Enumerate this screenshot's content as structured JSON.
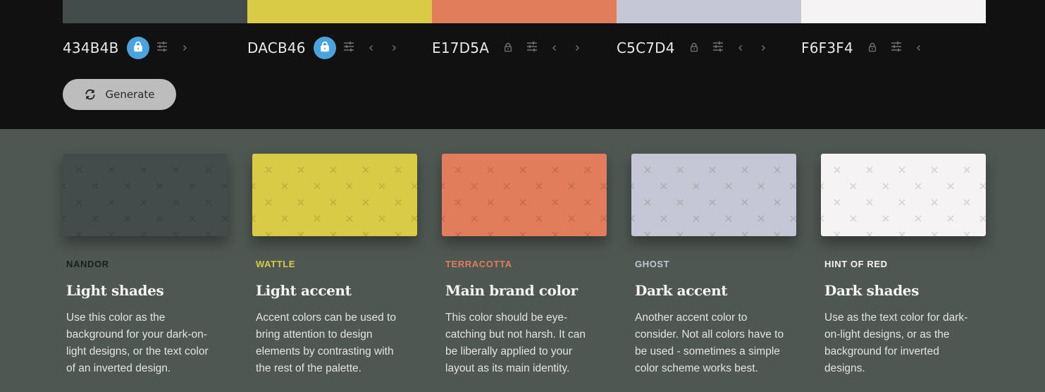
{
  "icons": {
    "lock": "lock-icon",
    "adjust": "sliders-icon",
    "prev": "chevron-left-icon",
    "next": "chevron-right-icon",
    "generate": "refresh-icon"
  },
  "palette": [
    {
      "hex": "434B4B",
      "color": "#434b4b",
      "locked": true,
      "has_prev": false,
      "has_next": true
    },
    {
      "hex": "DACB46",
      "color": "#dacb46",
      "locked": true,
      "has_prev": true,
      "has_next": true
    },
    {
      "hex": "E17D5A",
      "color": "#e17d5a",
      "locked": false,
      "has_prev": true,
      "has_next": true
    },
    {
      "hex": "C5C7D4",
      "color": "#c5c7d4",
      "locked": false,
      "has_prev": true,
      "has_next": true
    },
    {
      "hex": "F6F3F4",
      "color": "#f6f3f4",
      "locked": false,
      "has_prev": true,
      "has_next": false
    }
  ],
  "generate": {
    "label": "Generate"
  },
  "cards": [
    {
      "name": "NANDOR",
      "name_color": "#1a1e1c",
      "title": "Light shades",
      "description": "Use this color as the background for your dark-on-light designs, or the text color of an inverted design."
    },
    {
      "name": "WATTLE",
      "name_color": "#dacb46",
      "title": "Light accent",
      "description": "Accent colors can be used to bring attention to design elements by contrasting with the rest of the palette."
    },
    {
      "name": "TERRACOTTA",
      "name_color": "#e17d5a",
      "title": "Main brand color",
      "description": "This color should be eye-catching but not harsh. It can be liberally applied to your layout as its main identity."
    },
    {
      "name": "GHOST",
      "name_color": "#c5c7d4",
      "title": "Dark accent",
      "description": "Another accent color to consider. Not all colors have to be used - sometimes a simple color scheme works best."
    },
    {
      "name": "HINT OF RED",
      "name_color": "#f6f3f4",
      "title": "Dark shades",
      "description": "Use as the text color for dark-on-light designs, or as the background for inverted designs."
    }
  ]
}
